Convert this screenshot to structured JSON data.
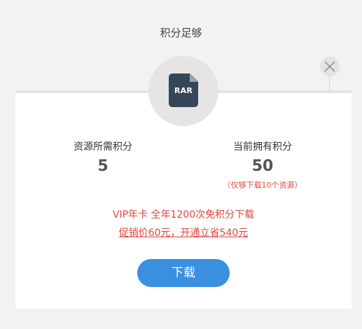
{
  "dialog": {
    "title": "积分足够",
    "file_type": "RAR"
  },
  "stats": {
    "required_label": "资源所需积分",
    "required_value": "5",
    "current_label": "当前拥有积分",
    "current_value": "50",
    "current_note": "（仅够下载10个资源）"
  },
  "promo": {
    "line1": "VIP年卡 全年1200次免积分下载",
    "line2": "促销价60元，开通立省540元"
  },
  "actions": {
    "download_label": "下载"
  },
  "colors": {
    "accent": "#3a8fe0",
    "promo_red": "#e0453d",
    "file_icon": "#354657"
  }
}
